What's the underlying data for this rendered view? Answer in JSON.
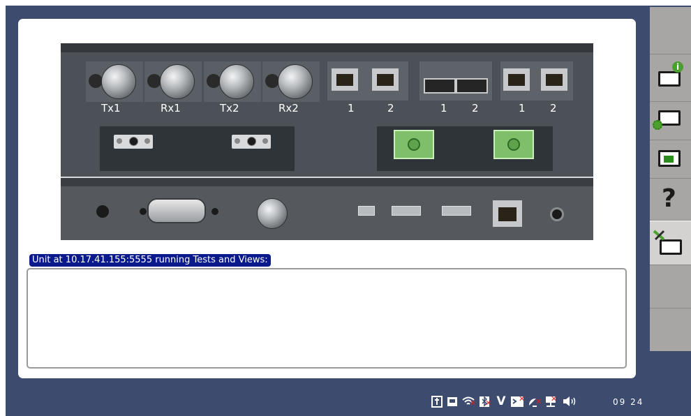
{
  "panel": {
    "bnc_labels": [
      "Tx1",
      "Rx1",
      "Tx2",
      "Rx2"
    ],
    "rj45_group1_labels": [
      "1",
      "2"
    ],
    "sfp_labels": [
      "1",
      "2"
    ],
    "rj45_group2_labels": [
      "1",
      "2"
    ]
  },
  "console": {
    "label": "Unit at 10.17.41.155:5555 running Tests and Views:",
    "text": ""
  },
  "sidebar": {
    "help_glyph": "?"
  },
  "status": {
    "icons": [
      "power-plug-icon",
      "storage-icon",
      "wifi-icon",
      "bluetooth-icon",
      "v-icon",
      "terminal-icon",
      "satellite-icon",
      "network-icon",
      "speaker-icon"
    ],
    "time": "09 24"
  },
  "colors": {
    "desktop": "#3c4b6e",
    "panel": "#4b4f55",
    "label_highlight": "#0a1a8c",
    "fiber_green": "#7fbf6a"
  }
}
